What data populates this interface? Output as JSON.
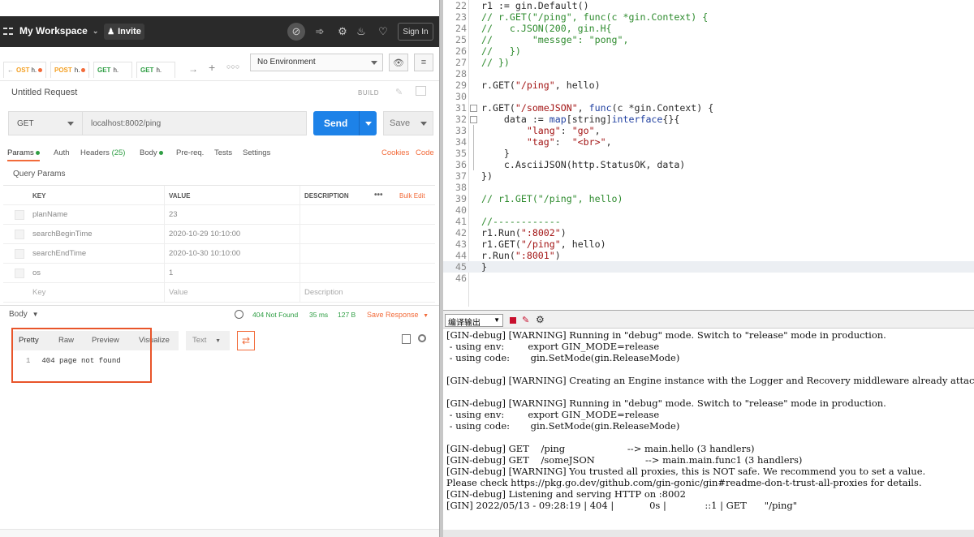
{
  "postman": {
    "header": {
      "workspace": "My Workspace",
      "invite": "Invite",
      "sign_in": "Sign In"
    },
    "tabs": [
      {
        "method": "OST",
        "label": "h."
      },
      {
        "method": "POST",
        "label": "h."
      },
      {
        "method": "GET",
        "label": "h."
      },
      {
        "method": "GET",
        "label": "h."
      }
    ],
    "environment": "No Environment",
    "request_name": "Untitled Request",
    "build_label": "BUILD",
    "method": "GET",
    "url": "localhost:8002/ping",
    "send": "Send",
    "save": "Save",
    "request_tabs": {
      "params": "Params",
      "auth": "Auth",
      "headers": "Headers",
      "headers_count": "(25)",
      "body": "Body",
      "prereq": "Pre-req.",
      "tests": "Tests",
      "settings": "Settings",
      "cookies": "Cookies",
      "code": "Code"
    },
    "query_params_label": "Query Params",
    "table": {
      "headers": {
        "key": "KEY",
        "value": "VALUE",
        "description": "DESCRIPTION",
        "more": "•••",
        "bulk_edit": "Bulk Edit"
      },
      "rows": [
        {
          "key": "planName",
          "value": "23"
        },
        {
          "key": "searchBeginTime",
          "value": "2020-10-29 10:10:00"
        },
        {
          "key": "searchEndTime",
          "value": "2020-10-30 10:10:00"
        },
        {
          "key": "os",
          "value": "1"
        }
      ],
      "placeholder": {
        "key": "Key",
        "value": "Value",
        "description": "Description"
      }
    },
    "response": {
      "body_label": "Body",
      "status": "404 Not Found",
      "time": "35 ms",
      "size": "127 B",
      "save_response": "Save Response",
      "view_tabs": [
        "Pretty",
        "Raw",
        "Preview",
        "Visualize"
      ],
      "format": "Text",
      "line_number": "1",
      "content": "404 page not found"
    }
  },
  "editor": {
    "lines": [
      {
        "n": "22",
        "code": "r1 := gin.Default()"
      },
      {
        "n": "23",
        "code": "// r.GET(\"/ping\", func(c *gin.Context) {"
      },
      {
        "n": "24",
        "code": "//   c.JSON(200, gin.H{"
      },
      {
        "n": "25",
        "code": "//       \"messge\": \"pong\","
      },
      {
        "n": "26",
        "code": "//   })"
      },
      {
        "n": "27",
        "code": "// })"
      },
      {
        "n": "28",
        "code": ""
      },
      {
        "n": "29",
        "code": "r.GET(\"/ping\", hello)"
      },
      {
        "n": "30",
        "code": ""
      },
      {
        "n": "31",
        "code": "r.GET(\"/someJSON\", func(c *gin.Context) {"
      },
      {
        "n": "32",
        "code": "    data := map[string]interface{}{"
      },
      {
        "n": "33",
        "code": "        \"lang\": \"go\","
      },
      {
        "n": "34",
        "code": "        \"tag\":  \"<br>\","
      },
      {
        "n": "35",
        "code": "    }"
      },
      {
        "n": "36",
        "code": "    c.AsciiJSON(http.StatusOK, data)"
      },
      {
        "n": "37",
        "code": "})"
      },
      {
        "n": "38",
        "code": ""
      },
      {
        "n": "39",
        "code": "// r1.GET(\"/ping\", hello)"
      },
      {
        "n": "40",
        "code": ""
      },
      {
        "n": "41",
        "code": "//------------"
      },
      {
        "n": "42",
        "code": "r1.Run(\":8002\")"
      },
      {
        "n": "43",
        "code": "r1.GET(\"/ping\", hello)"
      },
      {
        "n": "44",
        "code": "r.Run(\":8001\")"
      },
      {
        "n": "45",
        "code": "}"
      },
      {
        "n": "46",
        "code": ""
      }
    ]
  },
  "output": {
    "select_label": "编译输出",
    "text": "[GIN-debug] [WARNING] Running in \"debug\" mode. Switch to \"release\" mode in production.\n - using env:        export GIN_MODE=release\n - using code:       gin.SetMode(gin.ReleaseMode)\n\n[GIN-debug] [WARNING] Creating an Engine instance with the Logger and Recovery middleware already attache\n\n[GIN-debug] [WARNING] Running in \"debug\" mode. Switch to \"release\" mode in production.\n - using env:        export GIN_MODE=release\n - using code:       gin.SetMode(gin.ReleaseMode)\n\n[GIN-debug] GET    /ping                     --> main.hello (3 handlers)\n[GIN-debug] GET    /someJSON                 --> main.main.func1 (3 handlers)\n[GIN-debug] [WARNING] You trusted all proxies, this is NOT safe. We recommend you to set a value.\nPlease check https://pkg.go.dev/github.com/gin-gonic/gin#readme-don-t-trust-all-proxies for details.\n[GIN-debug] Listening and serving HTTP on :8002\n[GIN] 2022/05/13 - 09:28:19 | 404 |            0s |             ::1 | GET      \"/ping\""
  },
  "colors": {
    "accent": "#f26b3a",
    "send": "#1d82e8",
    "success": "#2f9e44",
    "header": "#2a2a2a",
    "highlight": "#e8552a"
  }
}
